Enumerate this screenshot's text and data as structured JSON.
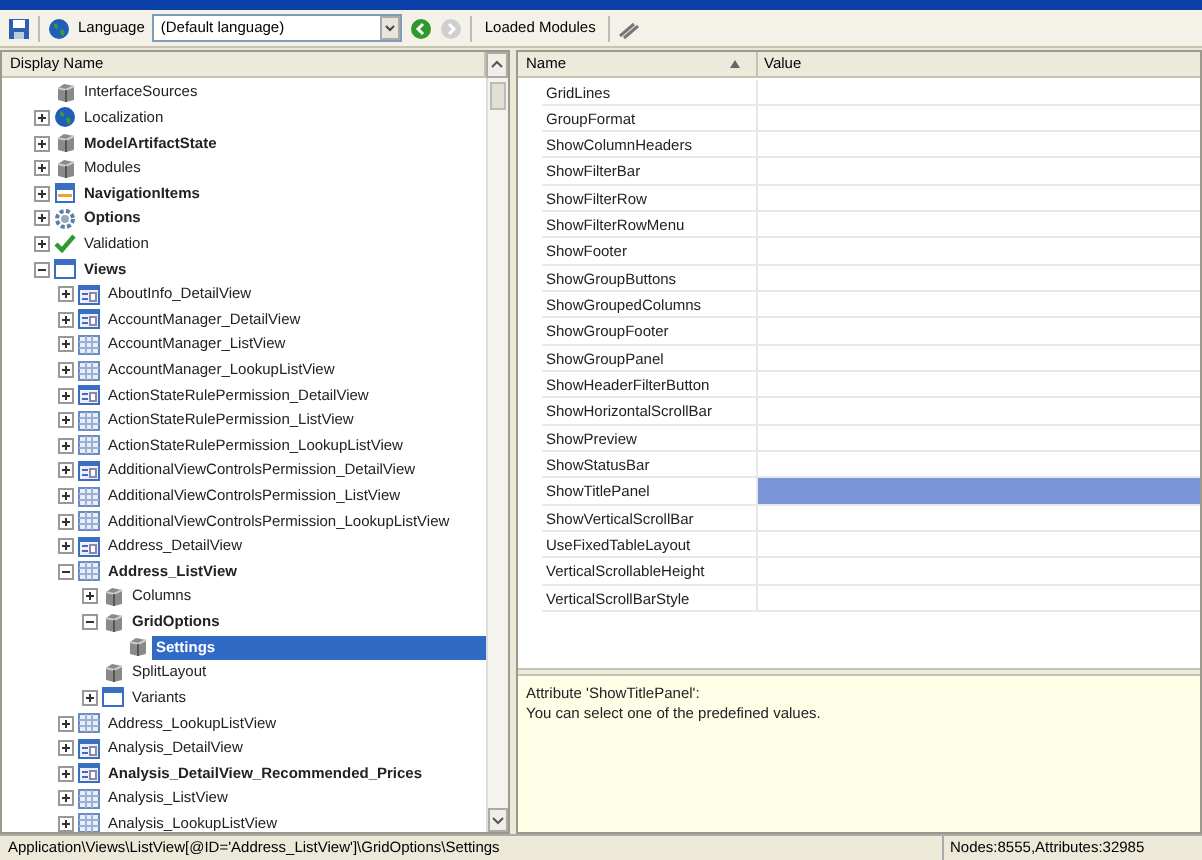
{
  "toolbar": {
    "language_label": "Language",
    "language_value": "(Default language)",
    "nav_buttons": [
      {
        "kind": "back",
        "disabled": false
      },
      {
        "kind": "forward",
        "disabled": true
      }
    ],
    "modules_button": "Loaded Modules"
  },
  "tree": {
    "header": "Display Name",
    "items": [
      {
        "name": "InterfaceSources",
        "kind": "cube",
        "bold": false,
        "selected": false
      },
      {
        "name": "Localization",
        "kind": "globe",
        "bold": false,
        "selected": false,
        "expanded": false
      },
      {
        "name": "ModelArtifactState",
        "kind": "cube",
        "bold": true,
        "selected": false,
        "expanded": false
      },
      {
        "name": "Modules",
        "kind": "cube",
        "bold": false,
        "selected": false,
        "expanded": false
      },
      {
        "name": "NavigationItems",
        "kind": "navigation",
        "bold": true,
        "selected": false,
        "expanded": false
      },
      {
        "name": "Options",
        "kind": "gear",
        "bold": true,
        "selected": false,
        "expanded": false
      },
      {
        "name": "Validation",
        "kind": "check",
        "bold": false,
        "selected": false,
        "expanded": false
      },
      {
        "name": "Views",
        "kind": "views",
        "bold": true,
        "selected": false,
        "expanded": true,
        "children": [
          {
            "name": "AboutInfo_DetailView",
            "kind": "detail",
            "bold": false,
            "selected": false,
            "expanded": false
          },
          {
            "name": "AccountManager_DetailView",
            "kind": "detail",
            "bold": false,
            "selected": false,
            "expanded": false
          },
          {
            "name": "AccountManager_ListView",
            "kind": "list",
            "bold": false,
            "selected": false,
            "expanded": false
          },
          {
            "name": "AccountManager_LookupListView",
            "kind": "list",
            "bold": false,
            "selected": false,
            "expanded": false
          },
          {
            "name": "ActionStateRulePermission_DetailView",
            "kind": "detail",
            "bold": false,
            "selected": false,
            "expanded": false
          },
          {
            "name": "ActionStateRulePermission_ListView",
            "kind": "list",
            "bold": false,
            "selected": false,
            "expanded": false
          },
          {
            "name": "ActionStateRulePermission_LookupListView",
            "kind": "list",
            "bold": false,
            "selected": false,
            "expanded": false
          },
          {
            "name": "AdditionalViewControlsPermission_DetailView",
            "kind": "detail",
            "bold": false,
            "selected": false,
            "expanded": false
          },
          {
            "name": "AdditionalViewControlsPermission_ListView",
            "kind": "list",
            "bold": false,
            "selected": false,
            "expanded": false
          },
          {
            "name": "AdditionalViewControlsPermission_LookupListView",
            "kind": "list",
            "bold": false,
            "selected": false,
            "expanded": false
          },
          {
            "name": "Address_DetailView",
            "kind": "detail",
            "bold": false,
            "selected": false,
            "expanded": false
          },
          {
            "name": "Address_ListView",
            "kind": "list",
            "bold": true,
            "selected": false,
            "expanded": true,
            "children": [
              {
                "name": "Columns",
                "kind": "cube",
                "bold": false,
                "selected": false,
                "expanded": false
              },
              {
                "name": "GridOptions",
                "kind": "cube",
                "bold": true,
                "selected": false,
                "expanded": true,
                "children": [
                  {
                    "name": "Settings",
                    "kind": "cube",
                    "bold": true,
                    "selected": true
                  }
                ]
              },
              {
                "name": "SplitLayout",
                "kind": "cube",
                "bold": false,
                "selected": false
              },
              {
                "name": "Variants",
                "kind": "views",
                "bold": false,
                "selected": false,
                "expanded": false
              }
            ]
          },
          {
            "name": "Address_LookupListView",
            "kind": "list",
            "bold": false,
            "selected": false,
            "expanded": false
          },
          {
            "name": "Analysis_DetailView",
            "kind": "detail",
            "bold": false,
            "selected": false,
            "expanded": false
          },
          {
            "name": "Analysis_DetailView_Recommended_Prices",
            "kind": "detail",
            "bold": true,
            "selected": false,
            "expanded": false
          },
          {
            "name": "Analysis_ListView",
            "kind": "list",
            "bold": false,
            "selected": false,
            "expanded": false
          },
          {
            "name": "Analysis_LookupListView",
            "kind": "list",
            "bold": false,
            "selected": false,
            "expanded": false
          }
        ]
      }
    ]
  },
  "grid": {
    "columns": [
      "Name",
      "Value"
    ],
    "rows": [
      {
        "name": "GridLines",
        "selected": false
      },
      {
        "name": "GroupFormat",
        "selected": false
      },
      {
        "name": "ShowColumnHeaders",
        "selected": false
      },
      {
        "name": "ShowFilterBar",
        "selected": false
      },
      {
        "name": "ShowFilterRow",
        "selected": false
      },
      {
        "name": "ShowFilterRowMenu",
        "selected": false
      },
      {
        "name": "ShowFooter",
        "selected": false
      },
      {
        "name": "ShowGroupButtons",
        "selected": false
      },
      {
        "name": "ShowGroupedColumns",
        "selected": false
      },
      {
        "name": "ShowGroupFooter",
        "selected": false
      },
      {
        "name": "ShowGroupPanel",
        "selected": false
      },
      {
        "name": "ShowHeaderFilterButton",
        "selected": false
      },
      {
        "name": "ShowHorizontalScrollBar",
        "selected": false
      },
      {
        "name": "ShowPreview",
        "selected": false
      },
      {
        "name": "ShowStatusBar",
        "selected": false
      },
      {
        "name": "ShowTitlePanel",
        "selected": true
      },
      {
        "name": "ShowVerticalScrollBar",
        "selected": false
      },
      {
        "name": "UseFixedTableLayout",
        "selected": false
      },
      {
        "name": "VerticalScrollableHeight",
        "selected": false
      },
      {
        "name": "VerticalScrollBarStyle",
        "selected": false
      }
    ]
  },
  "description": {
    "lines": [
      "Attribute 'ShowTitlePanel':",
      "You can select one of the predefined values."
    ]
  },
  "status_bar": {
    "path": "Application\\Views\\ListView[@ID='Address_ListView']\\GridOptions\\Settings",
    "counts": "Nodes:8555,Attributes:32985"
  }
}
